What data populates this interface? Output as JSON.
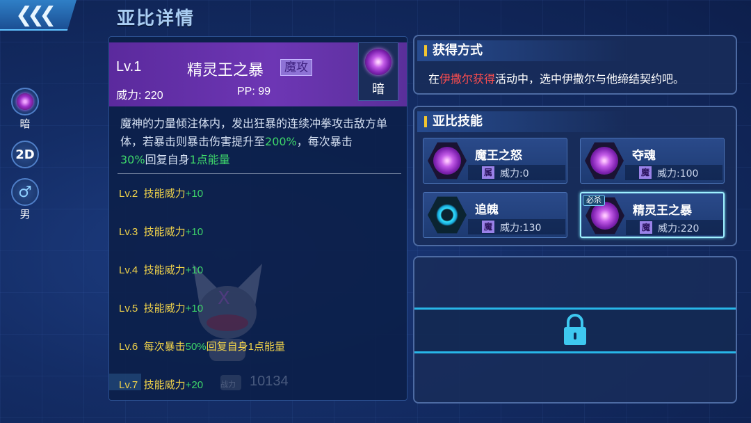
{
  "header": {
    "title": "亚比详情"
  },
  "attributes": {
    "element_label": "暗",
    "dimension_label": "2D",
    "gender_symbol": "♂",
    "gender_label": "男"
  },
  "skill_detail": {
    "level": "Lv.1",
    "name": "精灵王之暴",
    "type_tag": "魔攻",
    "power": "威力: 220",
    "pp": "PP: 99",
    "element": "暗",
    "description": {
      "p1": "魔神的力量倾注体内，发出狂暴的连续冲拳攻击敌方单体，若暴击则暴击伤害提升至",
      "p2": "200%",
      "p3": "，每次暴击",
      "p4": "30%",
      "p5": "回复自身",
      "p6": "1点能量"
    },
    "upgrades": [
      {
        "level": "Lv.2",
        "text": "技能威力",
        "value": "+10"
      },
      {
        "level": "Lv.3",
        "text": "技能威力",
        "value": "+10"
      },
      {
        "level": "Lv.4",
        "text": "技能威力",
        "value": "+10"
      },
      {
        "level": "Lv.5",
        "text": "技能威力",
        "value": "+10"
      },
      {
        "level": "Lv.6",
        "text": "每次暴击",
        "value": "50%",
        "suffix": "回复自身1点能量"
      },
      {
        "level": "Lv.7",
        "text": "技能威力",
        "value": "+20"
      }
    ]
  },
  "background": {
    "ghost_score": "10134",
    "ghost_icon_text": "战力"
  },
  "obtain": {
    "title": "获得方式",
    "text_before": "在",
    "highlight": "伊撒尔获得",
    "text_after": "活动中，选中伊撒尔与他缔结契约吧。"
  },
  "skills_panel": {
    "title": "亚比技能",
    "skills": [
      {
        "name": "魔王之怒",
        "type": "属",
        "power": "威力:0"
      },
      {
        "name": "夺魂",
        "type": "魔",
        "power": "威力:100"
      },
      {
        "name": "追魄",
        "type": "魔",
        "power": "威力:130"
      },
      {
        "name": "精灵王之暴",
        "type": "魔",
        "power": "威力:220",
        "badge": "必杀"
      }
    ]
  },
  "colors": {
    "accent_purple": "#6d36b4",
    "highlight_green": "#3ed66a",
    "highlight_red": "#ff4d4d",
    "level_yellow": "#f2d44a",
    "lock_cyan": "#28b6e8"
  }
}
